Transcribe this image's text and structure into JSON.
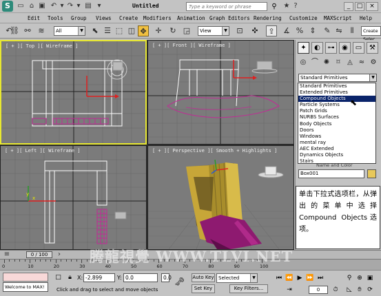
{
  "window": {
    "title": "Untitled",
    "search_placeholder": "Type a keyword or phrase"
  },
  "menu": [
    "Edit",
    "Tools",
    "Group",
    "Views",
    "Create",
    "Modifiers",
    "Animation",
    "Graph Editors",
    "Rendering",
    "Customize",
    "MAXScript",
    "Help"
  ],
  "toolbar": {
    "selection_filter": "All",
    "reference_coord": "View",
    "create_selection_set": "Create Selec"
  },
  "viewports": {
    "top": "[ + ][ Top ][ Wireframe ]",
    "front": "[ + ][ Front ][ Wireframe ]",
    "left": "[ + ][ Left ][ Wireframe ]",
    "perspective": "[ + ][ Perspective ][ Smooth + Highlights ]",
    "axis_x": "x",
    "axis_y": "y",
    "axis_z": "z"
  },
  "command_panel": {
    "primitive_dropdown": "Standard Primitives",
    "primitive_options": [
      "Standard Primitives",
      "Extended Primitives",
      "Compound Objects",
      "Particle Systems",
      "Patch Grids",
      "NURBS Surfaces",
      "Body Objects",
      "Doors",
      "Windows",
      "mental ray",
      "AEC Extended",
      "Dynamics Objects",
      "Stairs"
    ],
    "selected_option": "Compound Objects",
    "name_color_label": "Name and Color",
    "object_name": "Box001",
    "object_color": "#e8c85a"
  },
  "annotation": {
    "text": "单击下拉式选项栏，从弹出的菜单中选择 Compound Objects选项。"
  },
  "timeline": {
    "time_slider": "0 / 100",
    "ticks": [
      "0",
      "10",
      "20",
      "30",
      "40",
      "50",
      "60",
      "70",
      "80",
      "90",
      "100"
    ],
    "watermark": "腾龍視覺 WWW.TLVI.NET"
  },
  "status": {
    "maxscript": "Welcome to MAX!",
    "x_label": "X:",
    "x_value": "-2.899",
    "y_label": "Y:",
    "y_value": "0.0",
    "z_value": "0.0",
    "prompt": "Click and drag to select and move objects",
    "auto_key": "Auto Key",
    "set_key": "Set Key",
    "selected_mode": "Selected",
    "key_filters": "Key Filters...",
    "frame": "0"
  }
}
